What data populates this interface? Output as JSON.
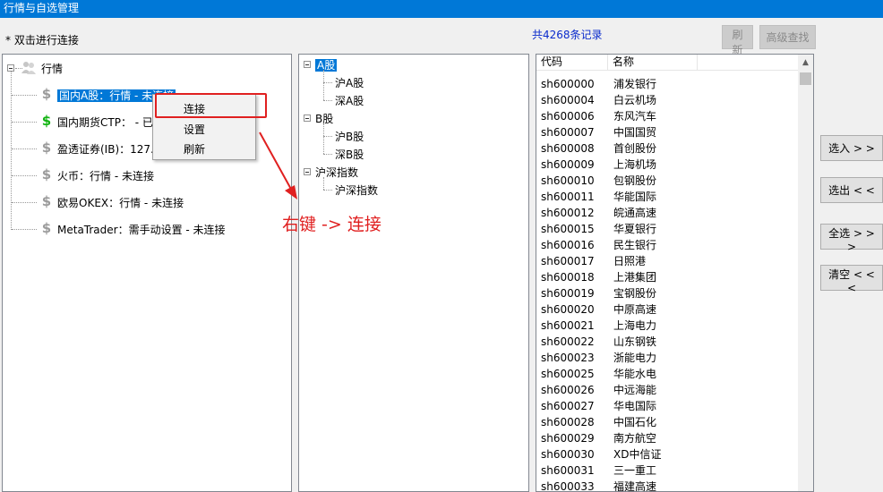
{
  "window": {
    "title": "行情与自选管理"
  },
  "hint": "* 双击进行连接",
  "record_count": "共4268条记录",
  "buttons": {
    "refresh": "刷新",
    "advanced_search": "高级查找",
    "select_in": "选入 > >",
    "select_out": "选出 < <",
    "select_all": "全选 > > >",
    "clear": "清空 < < <"
  },
  "market_tree": {
    "root": "行情",
    "items": [
      {
        "label": "国内A股：行情 - 未连接",
        "icon": "dollar-icon",
        "icon_color": "#9b9b9b",
        "selected": true
      },
      {
        "label": "国内期货CTP：  - 已",
        "icon": "dollar-icon",
        "icon_color": "#12b312"
      },
      {
        "label": "盈透证券(IB)：127.",
        "icon": "dollar-icon",
        "icon_color": "#9b9b9b"
      },
      {
        "label": "火币：行情 - 未连接",
        "icon": "dollar-icon",
        "icon_color": "#9b9b9b"
      },
      {
        "label": "欧易OKEX：行情 - 未连接",
        "icon": "dollar-icon",
        "icon_color": "#9b9b9b"
      },
      {
        "label": "MetaTrader：需手动设置 - 未连接",
        "icon": "dollar-icon",
        "icon_color": "#9b9b9b"
      }
    ]
  },
  "context_menu": {
    "items": [
      "连接",
      "设置",
      "刷新"
    ]
  },
  "annotation": "右键 -> 连接",
  "category_tree": {
    "groups": [
      {
        "label": "A股",
        "children": [
          "沪A股",
          "深A股"
        ],
        "selected": true
      },
      {
        "label": "B股",
        "children": [
          "沪B股",
          "深B股"
        ]
      },
      {
        "label": "沪深指数",
        "children": [
          "沪深指数"
        ]
      }
    ]
  },
  "stock_list": {
    "columns": [
      "代码",
      "名称",
      ""
    ],
    "rows": [
      [
        "sh600000",
        "浦发银行"
      ],
      [
        "sh600004",
        "白云机场"
      ],
      [
        "sh600006",
        "东风汽车"
      ],
      [
        "sh600007",
        "中国国贸"
      ],
      [
        "sh600008",
        "首创股份"
      ],
      [
        "sh600009",
        "上海机场"
      ],
      [
        "sh600010",
        "包钢股份"
      ],
      [
        "sh600011",
        "华能国际"
      ],
      [
        "sh600012",
        "皖通高速"
      ],
      [
        "sh600015",
        "华夏银行"
      ],
      [
        "sh600016",
        "民生银行"
      ],
      [
        "sh600017",
        "日照港"
      ],
      [
        "sh600018",
        "上港集团"
      ],
      [
        "sh600019",
        "宝钢股份"
      ],
      [
        "sh600020",
        "中原高速"
      ],
      [
        "sh600021",
        "上海电力"
      ],
      [
        "sh600022",
        "山东钢铁"
      ],
      [
        "sh600023",
        "浙能电力"
      ],
      [
        "sh600025",
        "华能水电"
      ],
      [
        "sh600026",
        "中远海能"
      ],
      [
        "sh600027",
        "华电国际"
      ],
      [
        "sh600028",
        "中国石化"
      ],
      [
        "sh600029",
        "南方航空"
      ],
      [
        "sh600030",
        "XD中信证"
      ],
      [
        "sh600031",
        "三一重工"
      ],
      [
        "sh600033",
        "福建高速"
      ]
    ]
  }
}
